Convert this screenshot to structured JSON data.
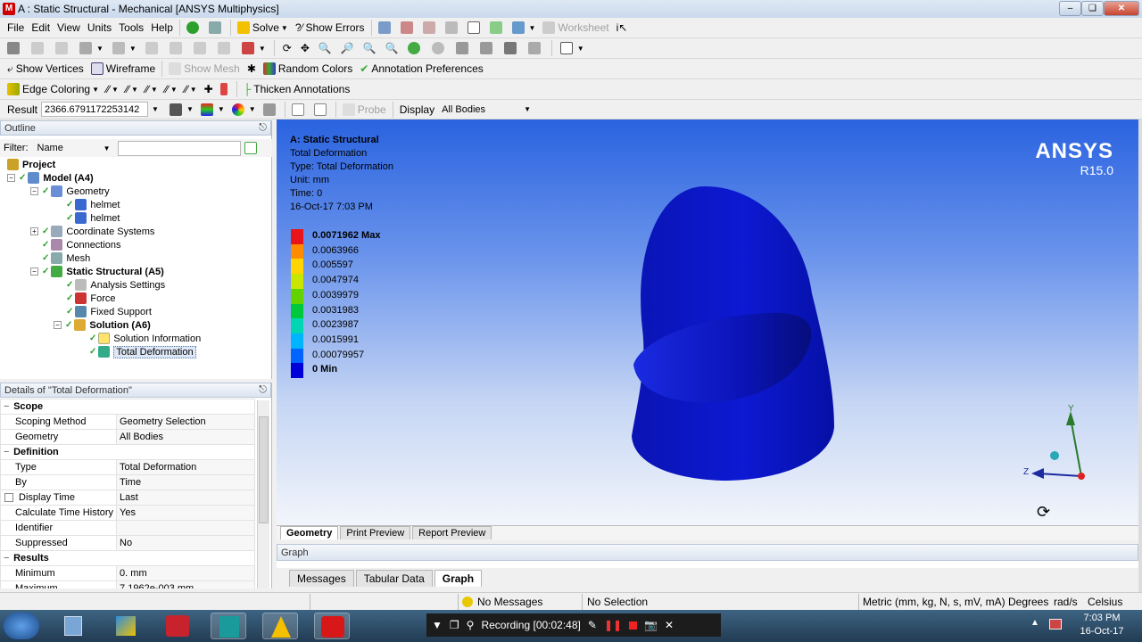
{
  "window": {
    "title": "A : Static Structural - Mechanical [ANSYS Multiphysics]",
    "app_icon": "M"
  },
  "menu": [
    "File",
    "Edit",
    "View",
    "Units",
    "Tools",
    "Help"
  ],
  "toolbar1": {
    "solve": "Solve",
    "show_errors": "Show Errors",
    "worksheet": "Worksheet"
  },
  "toolbar3": {
    "show_vertices": "Show Vertices",
    "wireframe": "Wireframe",
    "show_mesh": "Show Mesh",
    "random_colors": "Random Colors",
    "annotation_prefs": "Annotation Preferences"
  },
  "toolbar4": {
    "edge_coloring": "Edge Coloring",
    "thicken": "Thicken Annotations"
  },
  "toolbar5": {
    "result_label": "Result",
    "result_value": "2366.6791172253142",
    "probe": "Probe",
    "display_label": "Display",
    "display_value": "All Bodies"
  },
  "outline": {
    "header": "Outline",
    "filter_label": "Filter:",
    "filter_value": "Name",
    "tree": [
      {
        "label": "Project",
        "bold": true
      },
      {
        "label": "Model (A4)",
        "bold": true
      },
      {
        "label": "Geometry",
        "bold": false
      },
      {
        "label": "helmet",
        "bold": false
      },
      {
        "label": "helmet",
        "bold": false
      },
      {
        "label": "Coordinate Systems",
        "bold": false
      },
      {
        "label": "Connections",
        "bold": false
      },
      {
        "label": "Mesh",
        "bold": false
      },
      {
        "label": "Static Structural (A5)",
        "bold": true
      },
      {
        "label": "Analysis Settings",
        "bold": false
      },
      {
        "label": "Force",
        "bold": false
      },
      {
        "label": "Fixed Support",
        "bold": false
      },
      {
        "label": "Solution (A6)",
        "bold": true
      },
      {
        "label": "Solution Information",
        "bold": false
      },
      {
        "label": "Total Deformation",
        "bold": false
      }
    ]
  },
  "details": {
    "header": "Details of \"Total Deformation\"",
    "rows": [
      {
        "group": "Scope"
      },
      {
        "key": "Scoping Method",
        "value": "Geometry Selection"
      },
      {
        "key": "Geometry",
        "value": "All Bodies"
      },
      {
        "group": "Definition"
      },
      {
        "key": "Type",
        "value": "Total Deformation"
      },
      {
        "key": "By",
        "value": "Time"
      },
      {
        "key": "Display Time",
        "value": "Last"
      },
      {
        "key": "Calculate Time History",
        "value": "Yes"
      },
      {
        "key": "Identifier",
        "value": ""
      },
      {
        "key": "Suppressed",
        "value": "No"
      },
      {
        "group": "Results"
      },
      {
        "key": "Minimum",
        "value": "0. mm"
      },
      {
        "key": "Maximum",
        "value": "7.1962e-003 mm"
      }
    ]
  },
  "viewport": {
    "info": [
      "A: Static Structural",
      "Total Deformation",
      "Type: Total Deformation",
      "Unit: mm",
      "Time: 0",
      "16-Oct-17 7:03 PM"
    ],
    "brand": "ANSYS",
    "version": "R15.0",
    "legend": [
      {
        "label": "0.0071962 Max",
        "color": "#e8141a",
        "bold": true
      },
      {
        "label": "0.0063966",
        "color": "#ff8c00",
        "bold": false
      },
      {
        "label": "0.005597",
        "color": "#ffd400",
        "bold": false
      },
      {
        "label": "0.0047974",
        "color": "#c8e600",
        "bold": false
      },
      {
        "label": "0.0039979",
        "color": "#62d200",
        "bold": false
      },
      {
        "label": "0.0031983",
        "color": "#00c83c",
        "bold": false
      },
      {
        "label": "0.0023987",
        "color": "#00d6b4",
        "bold": false
      },
      {
        "label": "0.0015991",
        "color": "#00b4ff",
        "bold": false
      },
      {
        "label": "0.00079957",
        "color": "#0064ff",
        "bold": false
      },
      {
        "label": "0 Min",
        "color": "#0000d8",
        "bold": true
      }
    ],
    "axis": {
      "x": "X",
      "y": "Y",
      "z": "Z"
    },
    "body_color": "#0a14c8"
  },
  "view_tabs": [
    "Geometry",
    "Print Preview",
    "Report Preview"
  ],
  "graph_header": "Graph",
  "bottom_tabs": [
    "Messages",
    "Tabular Data",
    "Graph"
  ],
  "status": {
    "messages": "No Messages",
    "selection": "No Selection",
    "units": "Metric (mm, kg, N, s, mV, mA)",
    "angle": "Degrees",
    "rate": "rad/s",
    "temp": "Celsius"
  },
  "recorder": {
    "label": "Recording [00:02:48]"
  },
  "clock": {
    "time": "7:03 PM",
    "date": "16-Oct-17"
  }
}
